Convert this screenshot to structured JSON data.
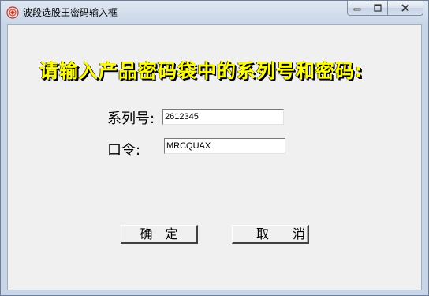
{
  "window": {
    "title": "波段选股王密码输入框",
    "icon": "app-icon",
    "caption_buttons": [
      "minimize-icon",
      "maximize-icon",
      "close-icon"
    ]
  },
  "dialog": {
    "heading": "请输入产品密码袋中的系列号和密码:",
    "serial_label": "系列号:",
    "serial_value": "2612345",
    "password_label": "口令:",
    "password_value": "MRCQUAX",
    "ok_button": "确定",
    "cancel_button": "取消"
  },
  "colors": {
    "heading": "#ffff00",
    "client_bg": "#f0f0f0",
    "frame": "#c9d6e8"
  }
}
